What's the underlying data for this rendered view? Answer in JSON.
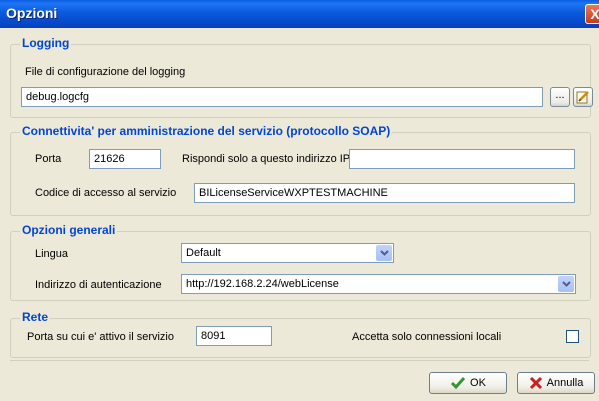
{
  "window": {
    "title": "Opzioni",
    "close": "X"
  },
  "logging": {
    "section_title": "Logging",
    "file_label": "File di configurazione del logging",
    "file_value": "debug.logcfg",
    "browse_label": "..."
  },
  "soap": {
    "section_title": "Connettivita' per amministrazione del servizio (protocollo SOAP)",
    "porta_label": "Porta",
    "porta_value": "21626",
    "ip_label": "Rispondi solo a questo indirizzo IP",
    "ip_value": "",
    "codice_label": "Codice di accesso al servizio",
    "codice_value": "BILicenseServiceWXPTESTMACHINE"
  },
  "general": {
    "section_title": "Opzioni generali",
    "lingua_label": "Lingua",
    "lingua_value": "Default",
    "auth_label": "Indirizzo di autenticazione",
    "auth_value": "http://192.168.2.24/webLicense"
  },
  "rete": {
    "section_title": "Rete",
    "port_label": "Porta su cui e' attivo il servizio",
    "port_value": "8091",
    "local_label": "Accetta solo connessioni locali",
    "local_checked": false
  },
  "buttons": {
    "ok": "OK",
    "cancel": "Annulla"
  },
  "colors": {
    "section_title": "#0046d5",
    "titlebar": "#0a5fe0",
    "ok_icon": "#2e9a2e",
    "cancel_icon": "#c82020"
  },
  "icons": {
    "edit": "edit-icon",
    "ok": "checkmark-icon",
    "cancel": "x-icon",
    "dropdown": "chevron-down-icon"
  }
}
